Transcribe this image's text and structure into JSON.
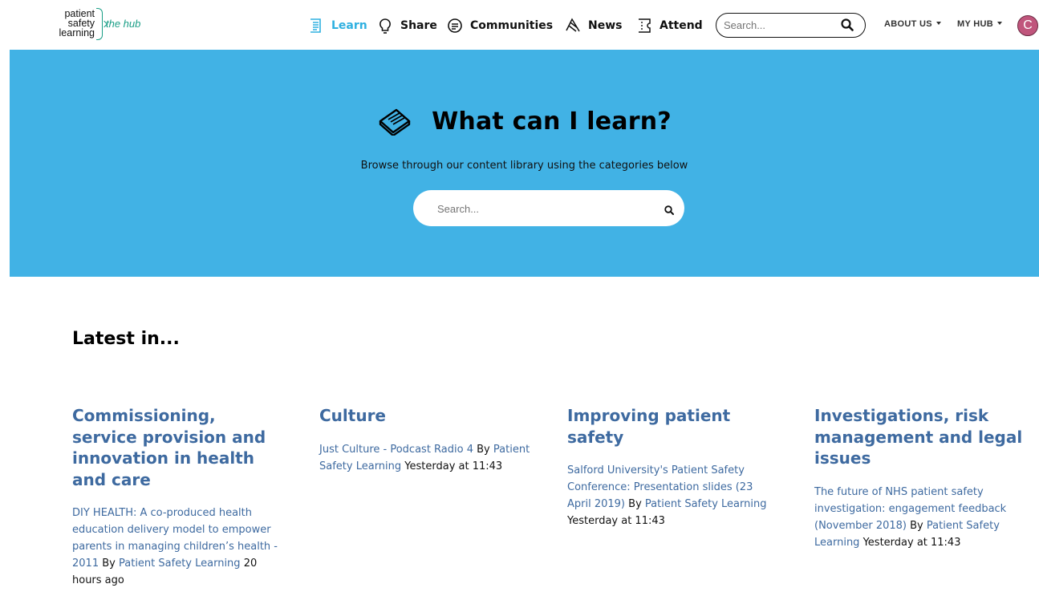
{
  "header": {
    "logo": {
      "line1": "patient",
      "line2": "safety",
      "line3": "learning",
      "tagline": "the hub"
    },
    "nav": [
      {
        "label": "Learn",
        "icon": "learn-icon",
        "active": true
      },
      {
        "label": "Share",
        "icon": "lightbulb-icon"
      },
      {
        "label": "Communities",
        "icon": "chat-icon"
      },
      {
        "label": "News",
        "icon": "news-icon"
      },
      {
        "label": "Attend",
        "icon": "ticket-icon"
      }
    ],
    "search_placeholder": "Search...",
    "about_us": "ABOUT US",
    "my_hub": "MY HUB",
    "avatar_letter": "C"
  },
  "hero": {
    "title": "What can I learn?",
    "subtitle": "Browse through our content library using the categories below",
    "search_placeholder": "Search...",
    "background_color": "#41b2e5"
  },
  "latest": {
    "title": "Latest in...",
    "columns": [
      {
        "heading": "Commissioning, service provision and innovation in health and care",
        "link_text": "DIY HEALTH: A co-produced health education delivery model to empower parents in managing children’s health - 2011",
        "by": "By",
        "author": "Patient Safety Learning",
        "time": "20 hours ago"
      },
      {
        "heading": "Culture",
        "link_text": "Just Culture - Podcast Radio 4",
        "by": "By",
        "author": "Patient Safety Learning",
        "time": "Yesterday at 11:43"
      },
      {
        "heading": "Improving patient safety",
        "link_text": "Salford University's Patient Safety Conference: Presentation slides (23 April 2019)",
        "by": "By",
        "author": "Patient Safety Learning",
        "time": "Yesterday at 11:43"
      },
      {
        "heading": "Investigations, risk management and legal issues",
        "link_text": "The future of NHS patient safety investigation: engagement feedback (November 2018)",
        "by": "By",
        "author": "Patient Safety Learning",
        "time": "Yesterday at 11:43"
      }
    ]
  },
  "colors": {
    "accent": "#2fb0e0",
    "brand_green": "#1a9e86",
    "link": "#3e6aa0",
    "avatar": "#c0557c"
  }
}
